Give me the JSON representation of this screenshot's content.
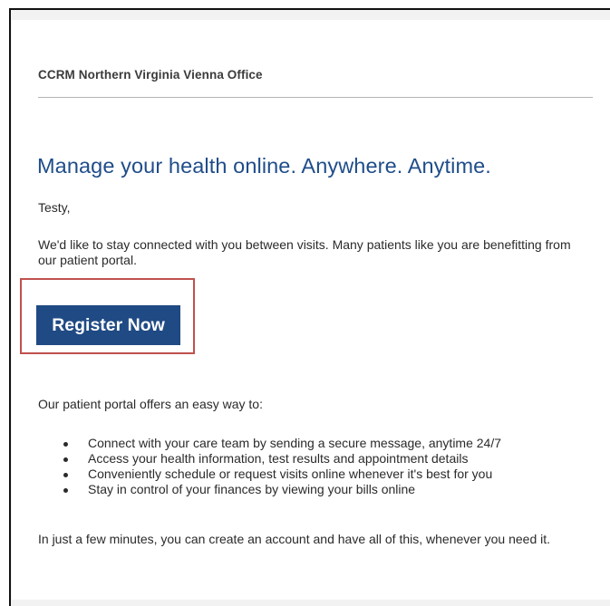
{
  "email": {
    "office_name": "CCRM Northern Virginia Vienna Office",
    "headline": "Manage your health online. Anywhere. Anytime.",
    "greeting": "Testy,",
    "intro": "We'd like to stay connected with you between visits. Many patients like you are benefitting from our patient portal.",
    "register_label": "Register Now",
    "offers_intro": "Our patient portal offers an easy way to:",
    "benefits": [
      "Connect with your care team by sending a secure message, anytime 24/7",
      "Access your health information, test results and appointment details",
      "Conveniently schedule or request visits online whenever it's best for you",
      "Stay in control of your finances by viewing your bills online"
    ],
    "closing": "In just a few minutes, you can create an account and have all of this, whenever you need it."
  },
  "colors": {
    "headline": "#1f4d8a",
    "button_bg": "#1f4a84",
    "highlight_border": "#c0504d"
  }
}
